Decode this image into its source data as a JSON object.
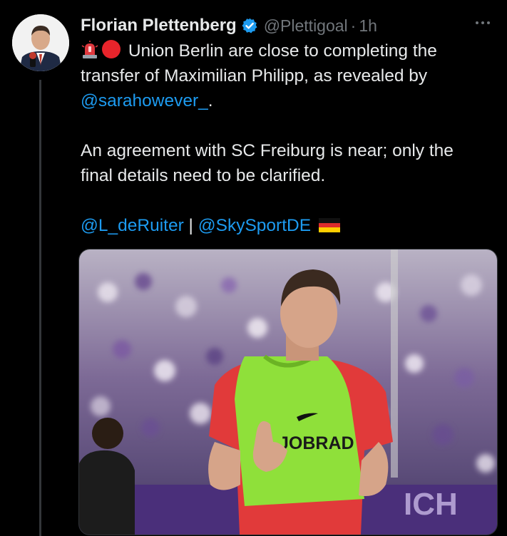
{
  "tweet": {
    "author": {
      "display_name": "Florian Plettenberg",
      "handle": "@Plettigoal",
      "separator": "·",
      "time": "1h",
      "verified": true
    },
    "text": {
      "line1": "Union Berlin are close to completing the",
      "line2": "transfer of Maximilian Philipp, as revealed by",
      "mention1": "@sarahowever_",
      "mention1_suffix": ".",
      "para2_line1": "An agreement with SC Freiburg is near; only the",
      "para2_line2": "final details need to be clarified.",
      "mention2": "@L_deRuiter",
      "divider": "|",
      "mention3": "@SkySportDE"
    },
    "emojis": [
      "rotating-light-icon",
      "red-circle-icon",
      "germany-flag-icon"
    ],
    "media": {
      "bib_text": "JOBRAD"
    }
  }
}
